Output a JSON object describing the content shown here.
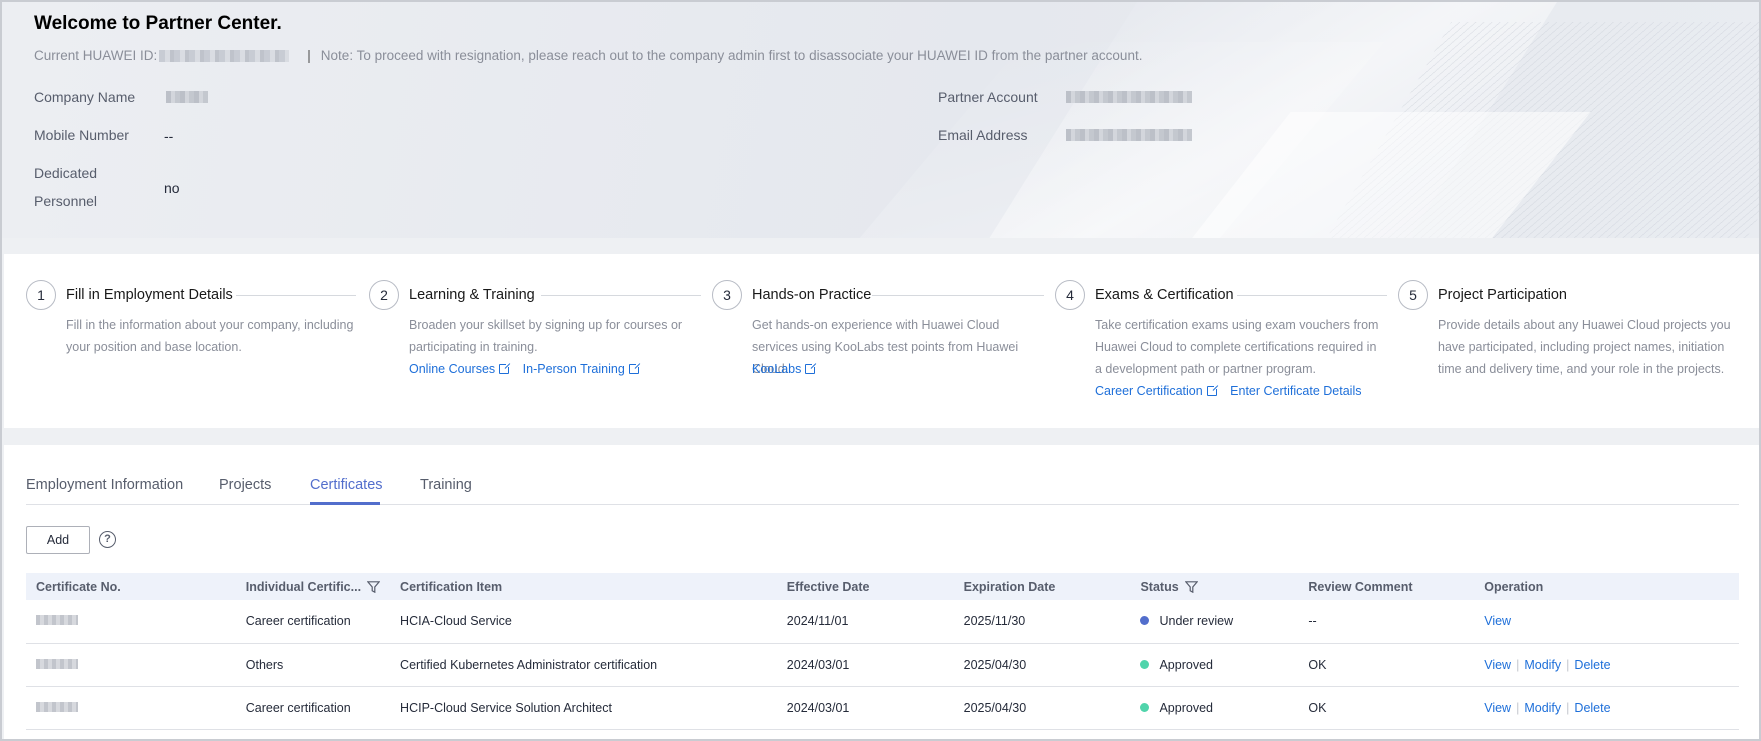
{
  "header": {
    "welcome": "Welcome to Partner Center.",
    "id_label": "Current HUAWEI ID:",
    "note": "Note: To proceed with resignation, please reach out to the company admin first to disassociate your HUAWEI ID from the partner account.",
    "company_name_label": "Company Name",
    "mobile_label": "Mobile Number",
    "mobile_value": "--",
    "dedicated_label_1": "Dedicated",
    "dedicated_label_2": "Personnel",
    "dedicated_value": "no",
    "partner_account_label": "Partner Account",
    "email_label": "Email Address"
  },
  "steps": [
    {
      "num": "1",
      "title": "Fill in Employment Details",
      "desc": "Fill in the information about your company, including your position and base location.",
      "links": []
    },
    {
      "num": "2",
      "title": "Learning & Training",
      "desc": "Broaden your skillset by signing up for courses or participating in training.",
      "links": [
        "Online Courses",
        "In-Person Training"
      ]
    },
    {
      "num": "3",
      "title": "Hands-on Practice",
      "desc": "Get hands-on experience with Huawei Cloud services using KooLabs test points from Huawei Cloud.",
      "links": [
        "KooLabs"
      ]
    },
    {
      "num": "4",
      "title": "Exams & Certification",
      "desc": "Take certification exams using exam vouchers from Huawei Cloud to complete certifications required in a development path or partner program.",
      "links": [
        "Career Certification",
        "Enter Certificate Details"
      ]
    },
    {
      "num": "5",
      "title": "Project Participation",
      "desc": "Provide details about any Huawei Cloud projects you have participated, including project names, initiation time and delivery time, and your role in the projects.",
      "links": []
    }
  ],
  "tabs": [
    "Employment Information",
    "Projects",
    "Certificates",
    "Training"
  ],
  "active_tab": "Certificates",
  "add_label": "Add",
  "help_glyph": "?",
  "table": {
    "headers": [
      "Certificate No.",
      "Individual Certific...",
      "Certification Item",
      "Effective Date",
      "Expiration Date",
      "Status",
      "Review Comment",
      "Operation"
    ],
    "rows": [
      {
        "type": "Career certification",
        "item": "HCIA-Cloud Service",
        "effective": "2024/11/01",
        "expiration": "2025/11/30",
        "status": "Under review",
        "status_color": "#526ecc",
        "comment": "--",
        "ops": [
          "View"
        ]
      },
      {
        "type": "Others",
        "item": "Certified Kubernetes Administrator certification",
        "effective": "2024/03/01",
        "expiration": "2025/04/30",
        "status": "Approved",
        "status_color": "#50d4ab",
        "comment": "OK",
        "ops": [
          "View",
          "Modify",
          "Delete"
        ]
      },
      {
        "type": "Career certification",
        "item": "HCIP-Cloud Service Solution Architect",
        "effective": "2024/03/01",
        "expiration": "2025/04/30",
        "status": "Approved",
        "status_color": "#50d4ab",
        "comment": "OK",
        "ops": [
          "View",
          "Modify",
          "Delete"
        ]
      }
    ]
  },
  "colors": {
    "accent": "#526ecc",
    "link": "#1e6fd9",
    "approved": "#50d4ab"
  }
}
